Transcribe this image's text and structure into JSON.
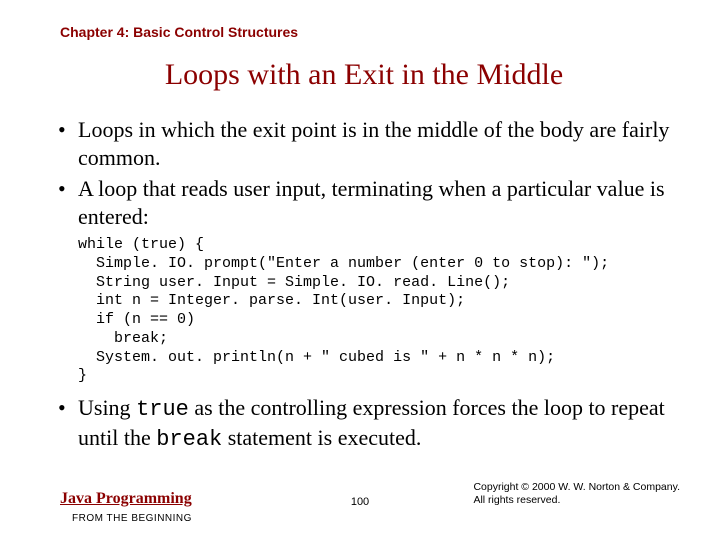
{
  "chapter": "Chapter 4: Basic Control Structures",
  "title": "Loops with an Exit in the Middle",
  "bullets": {
    "b1": "Loops in which the exit point is in the middle of the body are fairly common.",
    "b2": "A loop that reads user input, terminating when a particular value is entered:",
    "b3_pre": "Using ",
    "b3_code1": "true",
    "b3_mid": " as the controlling expression forces the loop to repeat until the ",
    "b3_code2": "break",
    "b3_post": " statement is executed."
  },
  "code": "while (true) {\n  Simple. IO. prompt(\"Enter a number (enter 0 to stop): \");\n  String user. Input = Simple. IO. read. Line();\n  int n = Integer. parse. Int(user. Input);\n  if (n == 0)\n    break;\n  System. out. println(n + \" cubed is \" + n * n * n);\n}",
  "footer": {
    "book": "Java Programming",
    "sub": "FROM THE BEGINNING",
    "page": "100",
    "copy_line1": "Copyright © 2000 W. W. Norton & Company.",
    "copy_line2": "All rights reserved."
  }
}
